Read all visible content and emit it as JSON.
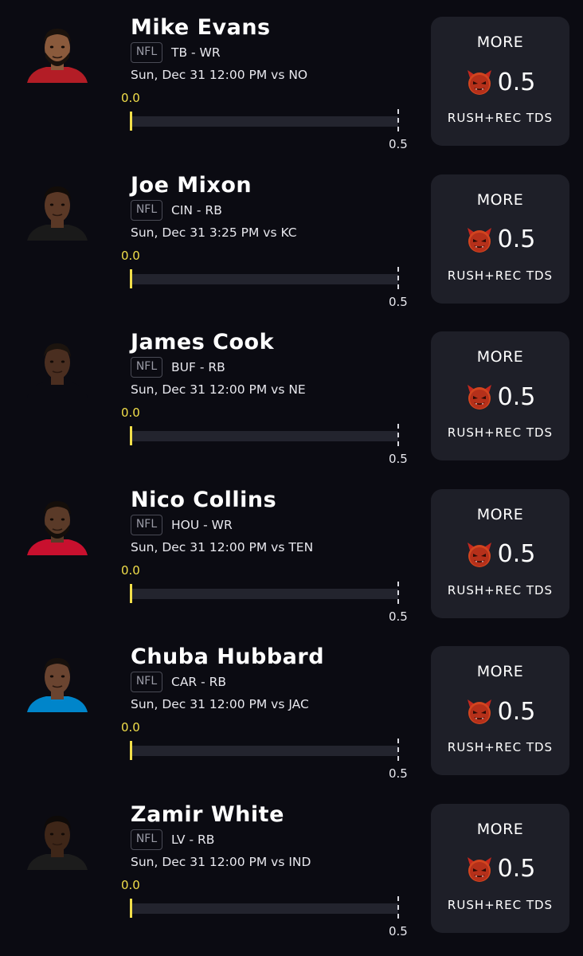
{
  "colors": {
    "background": "#0b0b12",
    "card": "#1e1f28",
    "accent_yellow": "#f2df4a",
    "track": "#23242e"
  },
  "picks": [
    {
      "name": "Mike Evans",
      "league": "NFL",
      "team_pos": "TB - WR",
      "game": "Sun, Dec 31 12:00 PM  vs NO",
      "current": "0.0",
      "target": "0.5",
      "progress": 0,
      "direction": "MORE",
      "line": "0.5",
      "stat": "RUSH+REC TDS",
      "avatar": {
        "skin": "#8a5a3c",
        "hair": "#1a120c",
        "beard": true,
        "jersey": "#b31d26"
      }
    },
    {
      "name": "Joe Mixon",
      "league": "NFL",
      "team_pos": "CIN - RB",
      "game": "Sun, Dec 31 3:25 PM  vs KC",
      "current": "0.0",
      "target": "0.5",
      "progress": 0,
      "direction": "MORE",
      "line": "0.5",
      "stat": "RUSH+REC TDS",
      "avatar": {
        "skin": "#5a3826",
        "hair": "#120c08",
        "beard": false,
        "jersey": "#1a1a1a"
      }
    },
    {
      "name": "James Cook",
      "league": "NFL",
      "team_pos": "BUF - RB",
      "game": "Sun, Dec 31 12:00 PM  vs NE",
      "current": "0.0",
      "target": "0.5",
      "progress": 0,
      "direction": "MORE",
      "line": "0.5",
      "stat": "RUSH+REC TDS",
      "avatar": {
        "skin": "#4a2e20",
        "hair": "#1c140e",
        "beard": false,
        "jersey": "#0b0b12"
      }
    },
    {
      "name": "Nico Collins",
      "league": "NFL",
      "team_pos": "HOU - WR",
      "game": "Sun, Dec 31 12:00 PM  vs TEN",
      "current": "0.0",
      "target": "0.5",
      "progress": 0,
      "direction": "MORE",
      "line": "0.5",
      "stat": "RUSH+REC TDS",
      "avatar": {
        "skin": "#5a3a28",
        "hair": "#140e0a",
        "beard": true,
        "jersey": "#c8102e"
      }
    },
    {
      "name": "Chuba Hubbard",
      "league": "NFL",
      "team_pos": "CAR - RB",
      "game": "Sun, Dec 31 12:00 PM  vs JAC",
      "current": "0.0",
      "target": "0.5",
      "progress": 0,
      "direction": "MORE",
      "line": "0.5",
      "stat": "RUSH+REC TDS",
      "avatar": {
        "skin": "#6a4430",
        "hair": "#16100c",
        "beard": false,
        "jersey": "#0085ca"
      }
    },
    {
      "name": "Zamir White",
      "league": "NFL",
      "team_pos": "LV - RB",
      "game": "Sun, Dec 31 12:00 PM  vs IND",
      "current": "0.0",
      "target": "0.5",
      "progress": 0,
      "direction": "MORE",
      "line": "0.5",
      "stat": "RUSH+REC TDS",
      "avatar": {
        "skin": "#3e2618",
        "hair": "#0e0a08",
        "beard": false,
        "jersey": "#1c1c1c"
      }
    }
  ]
}
